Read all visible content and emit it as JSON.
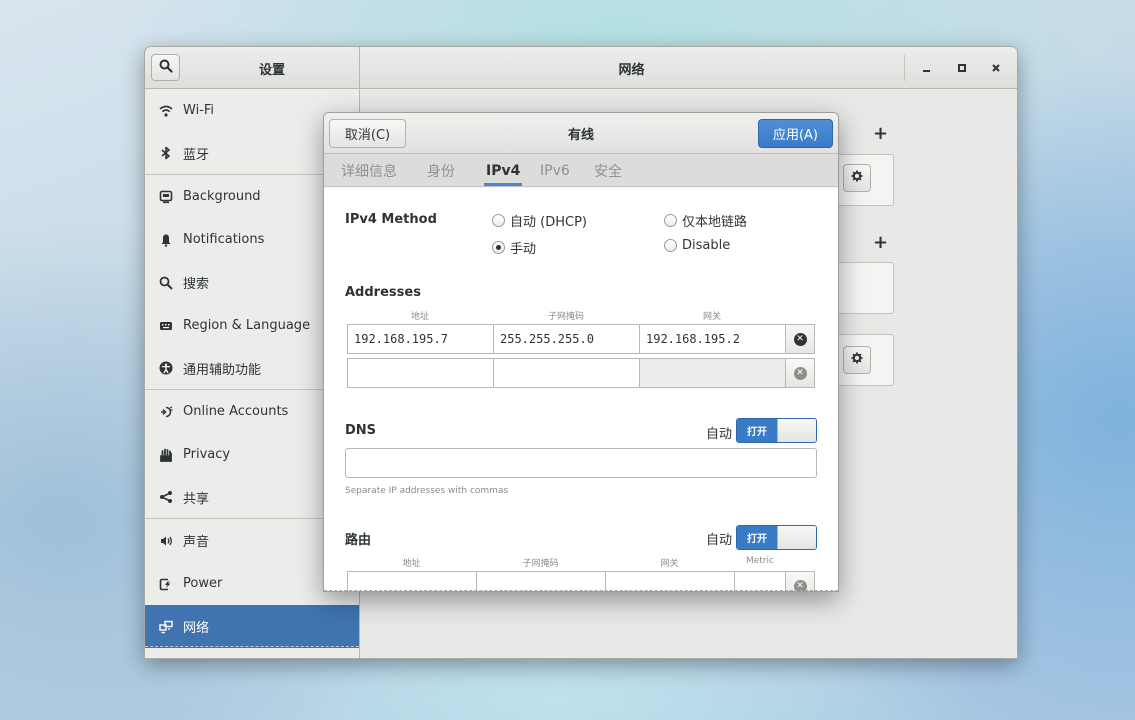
{
  "window": {
    "settings_title": "设置",
    "network_title": "网络",
    "controls": {
      "minimize": "–",
      "maximize": "▫",
      "close": "×"
    }
  },
  "sidebar": {
    "items": [
      {
        "label": "Wi-Fi",
        "icon": "wifi-icon"
      },
      {
        "label": "蓝牙",
        "icon": "bluetooth-icon"
      },
      {
        "label": "Background",
        "icon": "background-icon"
      },
      {
        "label": "Notifications",
        "icon": "bell-icon"
      },
      {
        "label": "搜索",
        "icon": "search-icon"
      },
      {
        "label": "Region & Language",
        "icon": "keyboard-icon"
      },
      {
        "label": "通用辅助功能",
        "icon": "accessibility-icon"
      },
      {
        "label": "Online Accounts",
        "icon": "online-accounts-icon"
      },
      {
        "label": "Privacy",
        "icon": "hand-icon"
      },
      {
        "label": "共享",
        "icon": "share-icon"
      },
      {
        "label": "声音",
        "icon": "speaker-icon"
      },
      {
        "label": "Power",
        "icon": "power-icon"
      },
      {
        "label": "网络",
        "icon": "network-icon",
        "active": true
      }
    ]
  },
  "content": {
    "add_symbol": "+"
  },
  "dialog": {
    "title": "有线",
    "cancel_label": "取消(C)",
    "apply_label": "应用(A)",
    "tabs": [
      "详细信息",
      "身份",
      "IPv4",
      "IPv6",
      "安全"
    ],
    "active_tab": "IPv4",
    "ipv4": {
      "method_label": "IPv4 Method",
      "methods": {
        "dhcp": "自动 (DHCP)",
        "link_local": "仅本地链路",
        "manual": "手动",
        "disable": "Disable"
      },
      "selected_method": "手动",
      "addresses_label": "Addresses",
      "addr_columns": [
        "地址",
        "子网掩码",
        "网关"
      ],
      "address_rows": [
        {
          "address": "192.168.195.7",
          "netmask": "255.255.255.0",
          "gateway": "192.168.195.2"
        },
        {
          "address": "",
          "netmask": "",
          "gateway": ""
        }
      ],
      "dns_label": "DNS",
      "dns_auto_label": "自动",
      "dns_auto_switch": "打开",
      "dns_value": "",
      "dns_hint": "Separate IP addresses with commas",
      "routes_label": "路由",
      "routes_auto_label": "自动",
      "routes_auto_switch": "打开",
      "route_columns": [
        "地址",
        "子网掩码",
        "网关",
        "Metric"
      ]
    }
  },
  "colors": {
    "accent": "#3a7bc8",
    "sidebar_active": "#3f74b0",
    "delete_active": "#2e3436",
    "delete_inactive": "#8c8f8a"
  }
}
